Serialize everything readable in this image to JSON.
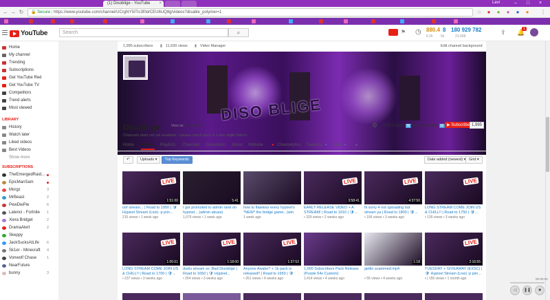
{
  "browser": {
    "tabs": [
      {
        "label": "(1) Disoblige - YouTube"
      },
      {
        "label": ""
      },
      {
        "label": ""
      }
    ],
    "address": {
      "secure_label": "Secure",
      "url": "https://www.youtube.com/channel/UCrgNY5iTIc3f0d/CEU6UQ8g/videos?disable_polymer=1"
    },
    "profile_name": "Levi"
  },
  "header": {
    "logo_text": "YouTube",
    "search_placeholder": "Search",
    "stats": {
      "val1": "880.4",
      "val2": "8",
      "val3": "180 929 782",
      "sub1": "6.2k",
      "sub2": "5k",
      "sub3": "23,408"
    },
    "notifications_badge": "1"
  },
  "sidebar": {
    "main": [
      {
        "label": "Home",
        "icon": "home-icon",
        "color": "#c33"
      },
      {
        "label": "My channel",
        "icon": "person-icon",
        "color": "#666"
      },
      {
        "label": "Trending",
        "icon": "fire-icon",
        "color": "#c33"
      },
      {
        "label": "Subscriptions",
        "icon": "subscriptions-icon",
        "color": "#c33"
      },
      {
        "label": "Get YouTube Red",
        "icon": "youtube-red-icon",
        "color": "#e62117"
      },
      {
        "label": "Get YouTube TV",
        "icon": "youtube-tv-icon",
        "color": "#e62117"
      },
      {
        "label": "Competitors",
        "icon": "competitors-icon",
        "color": "#444"
      },
      {
        "label": "Trend alerts",
        "icon": "alert-icon",
        "color": "#444"
      },
      {
        "label": "Most viewed",
        "icon": "chart-icon",
        "color": "#444"
      }
    ],
    "library_title": "LIBRARY",
    "library": [
      {
        "label": "History",
        "icon": "history-icon",
        "color": "#888"
      },
      {
        "label": "Watch later",
        "icon": "clock-icon",
        "color": "#888"
      },
      {
        "label": "Liked videos",
        "icon": "thumbs-up-icon",
        "color": "#888"
      },
      {
        "label": "Best Videos",
        "icon": "playlist-icon",
        "color": "#888"
      }
    ],
    "show_more": "Show more",
    "subs_title": "SUBSCRIPTIONS",
    "subs": [
      {
        "label": "TheEmergedRaid...",
        "count": "",
        "dot": true,
        "color": "#333"
      },
      {
        "label": "EpicManSam",
        "count": "",
        "dot": true,
        "color": "#b84"
      },
      {
        "label": "Morgz",
        "count": "3",
        "dot": false,
        "color": "#e44"
      },
      {
        "label": "MrBeast",
        "count": "2",
        "dot": false,
        "color": "#39c"
      },
      {
        "label": "PewDiePie",
        "count": "6",
        "dot": false,
        "color": "#c33"
      },
      {
        "label": "Latenci - Fortnite",
        "count": "1",
        "dot": false,
        "color": "#555"
      },
      {
        "label": "Xiera Bridget",
        "count": "2",
        "dot": false,
        "color": "#a7c"
      },
      {
        "label": "DramaAlert",
        "count": "2",
        "dot": false,
        "color": "#d22"
      },
      {
        "label": "Skeppy",
        "count": "",
        "dot": false,
        "color": "#3a3"
      },
      {
        "label": "JackSucksAtLife",
        "count": "6",
        "dot": false,
        "color": "#39f"
      },
      {
        "label": "Sk1er - Minecraft",
        "count": "4",
        "dot": false,
        "color": "#777"
      },
      {
        "label": "Vonwolf Chase",
        "count": "1",
        "dot": false,
        "color": "#444"
      },
      {
        "label": "NearFuture",
        "count": "",
        "dot": false,
        "color": "#569"
      },
      {
        "label": "bunny",
        "count": "3",
        "dot": false,
        "color": "#dbb"
      }
    ]
  },
  "channel": {
    "subscribers": "1,995 subscribers",
    "views": "11,630 views",
    "video_manager": "Video Manager",
    "edit_art": "Edit channel background",
    "name": "Disoblige",
    "view_as_label": "View as:",
    "view_as_value": "Yourself",
    "csv_export": "CSV Export",
    "add_competitor": "Add competitor",
    "subscribe": "Subscribe",
    "sub_count": "1,995",
    "notice": "Channels stats not yet available - please check back in a few days",
    "video_count": "14 Videos",
    "banner_text": "DISO BLIGE",
    "tabs": [
      "Home",
      "Videos",
      "Playlists",
      "Channels",
      "Discussion",
      "About",
      "Website",
      "Channelytics",
      "Trending",
      "Stats"
    ],
    "active_tab": "Videos"
  },
  "toolbar": {
    "uploads": "Uploads",
    "top_keywords": "Top Keywords",
    "date_added": "Date added (newest)",
    "grid": "Grid"
  },
  "videos": [
    {
      "title": "oof stream... | Road to 1950 | 🛡 Hypixel Stream (Live) :p join...",
      "meta": "215 views • 1 week ago",
      "dur": "1:51:00",
      "bg": "#4a2a5c",
      "live": true
    },
    {
      "title": "I got promoted to admin rank on hypixel... (admin abuse)",
      "meta": "1,075 views • 1 week ago",
      "dur": "5:41",
      "bg": "#2a2030",
      "live": false
    },
    {
      "title": "how to flawless every hypixel's *NEW* the bridge game.. (win all...",
      "meta": "1 week ago",
      "dur": "",
      "bg": "#5a4b6b",
      "live": false
    },
    {
      "title": "EARLY RELEASE VIDEO + A STREAM! | Road to 1910 | 🛡...",
      "meta": "• 329 views • 2 weeks ago",
      "dur": "3:58:41",
      "bg": "#4a2a5c",
      "live": true
    },
    {
      "title": "hi sorry 4 not uploading but stream ya | Road to 1800 | 🛡...",
      "meta": "• 156 views • 3 weeks ago",
      "dur": "4:37:50",
      "bg": "#4a2a5c",
      "live": true
    },
    {
      "title": "LONG STREAM COME JOIN US & CHILL!! | Road to 1750 | 🛡...",
      "meta": "• 135 views • 3 weeks ago",
      "dur": "",
      "bg": "#4a2a5c",
      "live": true
    },
    {
      "title": "LONG STREAM COME JOIN US & CHILL!! | Road to 1700 | 🛡...",
      "meta": "• 237 views • 3 weeks ago",
      "dur": "1:05:51",
      "bg": "#4a2a5c",
      "live": true
    },
    {
      "title": "duels stream so ;Bad Disoblige | Road to 1650 | 🛡 Hypixel...",
      "meta": "• 254 views • 3 weeks ago",
      "dur": "1:18:00",
      "bg": "#4a2a5c",
      "live": true
    },
    {
      "title": "Anyone Awake? + 1k pack is released!! | Road to 1650 | 🛡",
      "meta": "• 261 views • 4 weeks ago",
      "dur": "1:37:52",
      "bg": "#4a2a5c",
      "live": true
    },
    {
      "title": "1,000 Subscribers Pack Release (Purple 64x Custom)",
      "meta": "1,414 views • 4 weeks ago",
      "dur": "",
      "bg": "#6a3a8c",
      "live": false
    },
    {
      "title": "gettin scammed.mp4",
      "meta": "• 55 views • 4 weeks ago",
      "dur": "1:18",
      "bg": "#e8e8f0",
      "live": false
    },
    {
      "title": "TUESDAY + GIVEAWAY (EXSC) | 🛡 Hypixel Stream (Live) :p join...",
      "meta": "• | 155 views • 1 month ago",
      "dur": "2:16:55",
      "bg": "#4a2a5c",
      "live": true
    }
  ],
  "player": {
    "time": "00:00:00"
  }
}
